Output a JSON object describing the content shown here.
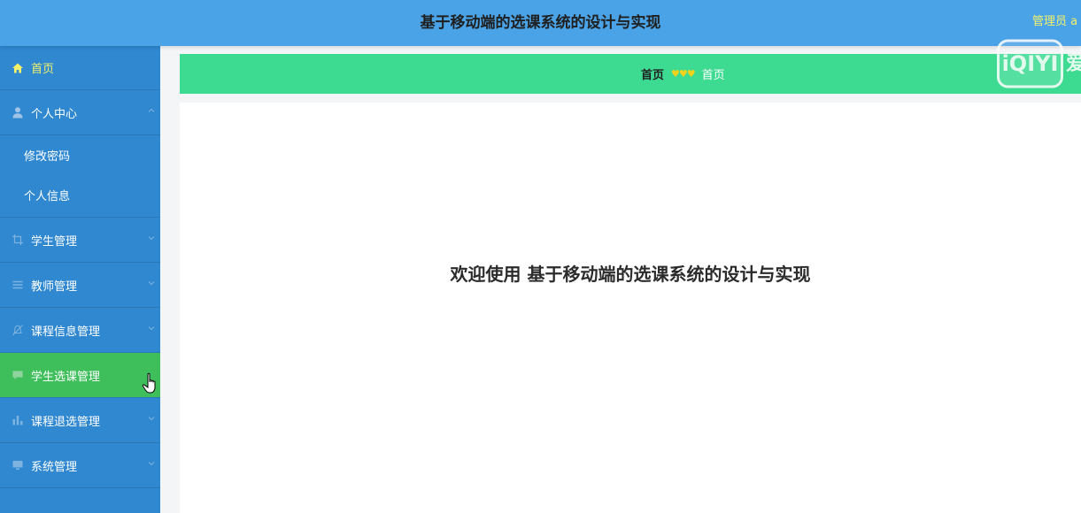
{
  "header": {
    "title": "基于移动端的选课系统的设计与实现",
    "user": "管理员 a"
  },
  "sidebar": {
    "items": [
      {
        "label": "首页",
        "icon": "home-icon"
      },
      {
        "label": "个人中心",
        "icon": "user-icon",
        "children": [
          "修改密码",
          "个人信息"
        ]
      },
      {
        "label": "学生管理",
        "icon": "crop-icon"
      },
      {
        "label": "教师管理",
        "icon": "menu-icon"
      },
      {
        "label": "课程信息管理",
        "icon": "bell-off-icon"
      },
      {
        "label": "学生选课管理",
        "icon": "message-icon"
      },
      {
        "label": "课程退选管理",
        "icon": "bar-chart-icon"
      },
      {
        "label": "系统管理",
        "icon": "monitor-icon"
      }
    ]
  },
  "breadcrumb": {
    "home": "首页",
    "separator": "♥♥♥",
    "current": "首页"
  },
  "main": {
    "welcome": "欢迎使用 基于移动端的选课系统的设计与实现"
  },
  "watermark": {
    "logo_text": "iQIYI",
    "trail_char": "爱"
  },
  "colors": {
    "header_bg": "#4aa3e6",
    "sidebar_bg": "#2f88d0",
    "active_bg": "#3fbf5b",
    "breadcrumb_bg": "#3ddb92",
    "highlight_text": "#f3f06a"
  }
}
